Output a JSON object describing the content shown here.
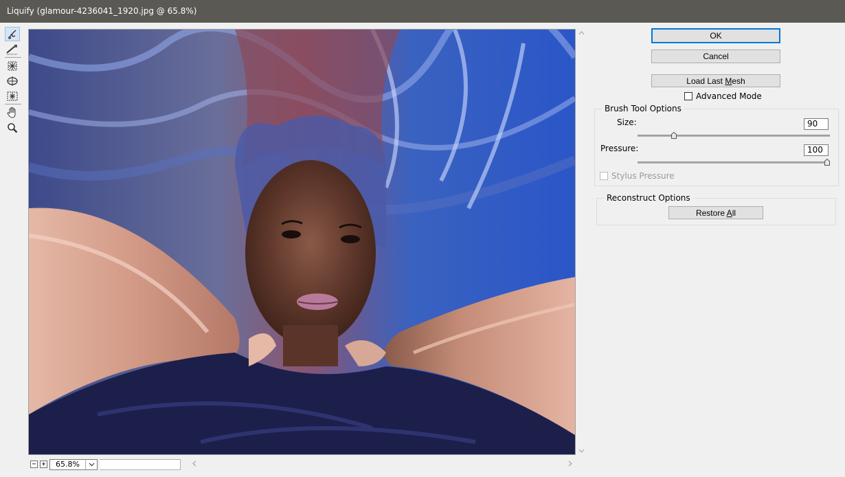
{
  "window": {
    "title": "Liquify (glamour-4236041_1920.jpg @ 65.8%)"
  },
  "tools": [
    {
      "name": "forward-warp-tool",
      "active": true
    },
    {
      "name": "reconstruct-tool",
      "active": false
    },
    {
      "name": "pucker-tool",
      "active": false
    },
    {
      "name": "bloat-tool",
      "active": false
    },
    {
      "name": "push-left-tool",
      "active": false
    },
    {
      "name": "hand-tool",
      "active": false
    },
    {
      "name": "zoom-tool",
      "active": false
    }
  ],
  "buttons": {
    "ok": "OK",
    "cancel": "Cancel",
    "load_last_mesh_pre": "Load Last ",
    "load_last_mesh_ul": "M",
    "load_last_mesh_post": "esh",
    "restore_all_pre": "Restore ",
    "restore_all_ul": "A",
    "restore_all_post": "ll"
  },
  "advanced_mode": {
    "label": "Advanced Mode",
    "checked": false
  },
  "brush_tool_options": {
    "title": "Brush Tool Options",
    "size_label": "Size:",
    "size_value": "90",
    "size_fraction": 0.18,
    "pressure_label": "Pressure:",
    "pressure_value": "100",
    "pressure_fraction": 1.0,
    "stylus_pressure_label": "Stylus Pressure",
    "stylus_pressure_checked": false
  },
  "reconstruct_options": {
    "title": "Reconstruct Options"
  },
  "status": {
    "zoom": "65.8%"
  }
}
